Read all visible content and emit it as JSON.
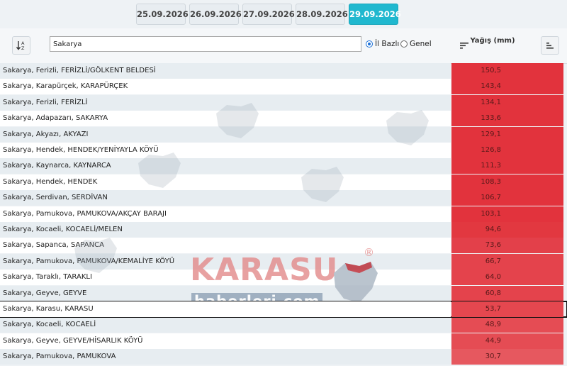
{
  "dates": [
    {
      "label": "25.09.2026",
      "active": false
    },
    {
      "label": "26.09.2026",
      "active": false
    },
    {
      "label": "27.09.2026",
      "active": false
    },
    {
      "label": "28.09.2026",
      "active": false
    },
    {
      "label": "29.09.2026",
      "active": true
    }
  ],
  "search": {
    "value": "Sakarya"
  },
  "filters": {
    "il_bazli_label": "İl Bazlı",
    "genel_label": "Genel",
    "selected": "il_bazli"
  },
  "table": {
    "value_header": "Yağış (mm)",
    "rows": [
      {
        "name": "Sakarya, Ferizli, FERİZLİ/GÖLKENT BELDESİ",
        "value": "150,5",
        "color": "#e2333d"
      },
      {
        "name": "Sakarya, Karapürçek, KARAPÜRÇEK",
        "value": "143,4",
        "color": "#e2333d"
      },
      {
        "name": "Sakarya, Ferizli, FERİZLİ",
        "value": "134,1",
        "color": "#e2333d"
      },
      {
        "name": "Sakarya, Adapazarı, SAKARYA",
        "value": "133,6",
        "color": "#e2333d"
      },
      {
        "name": "Sakarya, Akyazı, AKYAZI",
        "value": "129,1",
        "color": "#e2333d"
      },
      {
        "name": "Sakarya, Hendek, HENDEK/YENİYAYLA KÖYÜ",
        "value": "126,8",
        "color": "#e2333d"
      },
      {
        "name": "Sakarya, Kaynarca, KAYNARCA",
        "value": "111,3",
        "color": "#e2333d"
      },
      {
        "name": "Sakarya, Hendek, HENDEK",
        "value": "108,3",
        "color": "#e2333d"
      },
      {
        "name": "Sakarya, Serdivan, SERDİVAN",
        "value": "106,7",
        "color": "#e2333d"
      },
      {
        "name": "Sakarya, Pamukova, PAMUKOVA/AKÇAY BARAJI",
        "value": "103,1",
        "color": "#e2333d"
      },
      {
        "name": "Sakarya, Kocaeli, KOCAELİ/MELEN",
        "value": "94,6",
        "color": "#e23840"
      },
      {
        "name": "Sakarya, Sapanca, SAPANCA",
        "value": "73,6",
        "color": "#e3404a"
      },
      {
        "name": "Sakarya, Pamukova, PAMUKOVA/KEMALİYE KÖYÜ",
        "value": "66,7",
        "color": "#e4434c"
      },
      {
        "name": "Sakarya, Taraklı, TARAKLI",
        "value": "64,0",
        "color": "#e4434c"
      },
      {
        "name": "Sakarya, Geyve, GEYVE",
        "value": "60,8",
        "color": "#e4434c"
      },
      {
        "name": "Sakarya, Karasu, KARASU",
        "value": "53,7",
        "color": "#e5474f",
        "selected": true
      },
      {
        "name": "Sakarya, Kocaeli, KOCAELİ",
        "value": "48,9",
        "color": "#e54c54"
      },
      {
        "name": "Sakarya, Geyve, GEYVE/HİSARLIK KÖYÜ",
        "value": "44,9",
        "color": "#e54c54"
      },
      {
        "name": "Sakarya, Pamukova, PAMUKOVA",
        "value": "30,7",
        "color": "#e6585f"
      }
    ]
  },
  "watermark": {
    "brand": "KARASU",
    "sub": "haberleri.com",
    "reg": "®"
  }
}
